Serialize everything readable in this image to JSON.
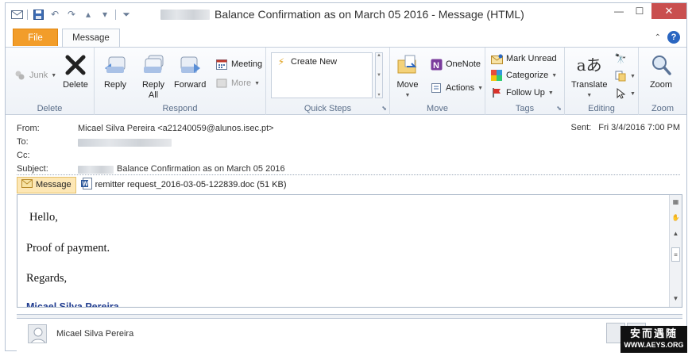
{
  "window": {
    "title": "Balance Confirmation as on March 05 2016  -  Message (HTML)"
  },
  "tabs": {
    "file": "File",
    "message": "Message"
  },
  "ribbon": {
    "delete": {
      "label": "Delete",
      "junk": "Junk",
      "delete": "Delete"
    },
    "respond": {
      "label": "Respond",
      "reply": "Reply",
      "reply_all_1": "Reply",
      "reply_all_2": "All",
      "forward": "Forward",
      "meeting": "Meeting",
      "more": "More"
    },
    "quick_steps": {
      "label": "Quick Steps",
      "create_new": "Create New"
    },
    "move": {
      "label": "Move",
      "move": "Move",
      "onenote": "OneNote",
      "actions": "Actions"
    },
    "tags": {
      "label": "Tags",
      "mark_unread": "Mark Unread",
      "categorize": "Categorize",
      "follow_up": "Follow Up"
    },
    "editing": {
      "label": "Editing",
      "translate": "Translate"
    },
    "zoom": {
      "label": "Zoom",
      "zoom": "Zoom"
    }
  },
  "header": {
    "from_label": "From:",
    "from_value": "Micael Silva Pereira <a21240059@alunos.isec.pt>",
    "to_label": "To:",
    "cc_label": "Cc:",
    "subject_label": "Subject:",
    "subject_value": "Balance Confirmation as on March 05 2016",
    "sent_label": "Sent:",
    "sent_value": "Fri 3/4/2016 7:00 PM"
  },
  "attachments": {
    "message_tab": "Message",
    "file": "remitter request_2016-03-05-122839.doc (51 KB)"
  },
  "body": {
    "greeting": "Hello,",
    "line1": "Proof of payment.",
    "closing": "Regards,",
    "signature": "Micael Silva Pereira"
  },
  "people_pane": {
    "name": "Micael Silva Pereira"
  },
  "watermark": {
    "line1": "安而遇随",
    "line2": "WWW.AEYS.ORG"
  }
}
